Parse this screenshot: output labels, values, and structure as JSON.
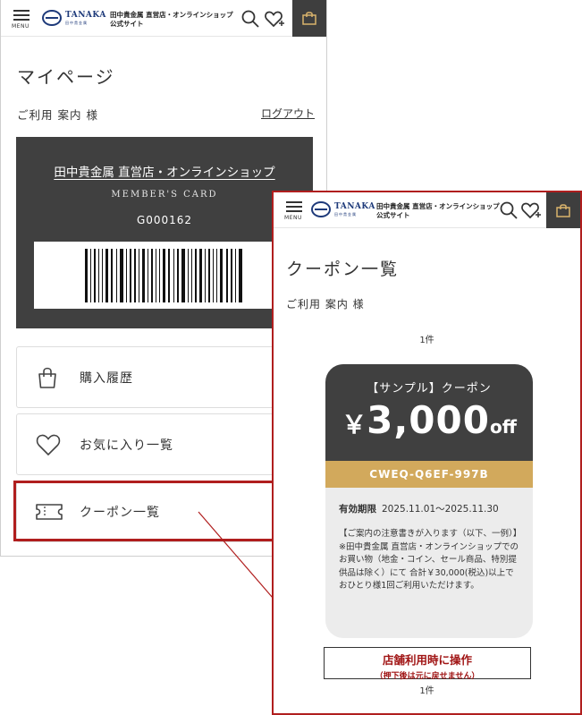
{
  "header": {
    "menu_label": "MENU",
    "logo_en": "TANAKA",
    "logo_jp": "田中貴金属",
    "store_line1": "田中貴金属 直営店・オンラインショップ",
    "store_line2": "公式サイト"
  },
  "mypage": {
    "title": "マイページ",
    "user_line": "ご利用 案内 様",
    "logout_label": "ログアウト",
    "card": {
      "title": "田中貴金属 直営店・オンラインショップ",
      "subtitle": "MEMBER'S CARD",
      "number": "G000162"
    },
    "menu": [
      {
        "label": "購入履歴",
        "icon": "shopping-bag-icon"
      },
      {
        "label": "お気に入り一覧",
        "icon": "heart-icon"
      },
      {
        "label": "クーポン一覧",
        "icon": "ticket-icon"
      }
    ]
  },
  "coupon_page": {
    "title": "クーポン一覧",
    "user_line": "ご利用 案内 様",
    "count_top": "1件",
    "count_bottom": "1件",
    "coupon": {
      "name": "【サンプル】クーポン",
      "yen": "￥",
      "amount": "3,000",
      "off": "off",
      "code": "CWEQ-Q6EF-997B",
      "valid_label": "有効期限",
      "valid_range": "2025.11.01～2025.11.30",
      "note": "【ご案内の注意書きが入ります（以下、一例）】※田中貴金属 直営店・オンラインショップでのお買い物（地金・コイン、セール商品、特別提供品は除く）にて 合計￥30,000(税込)以上でおひとり様1回ご利用いただけます。"
    },
    "store_button": {
      "line1": "店舗利用時に操作",
      "line2": "（押下後は元に戻せません）"
    }
  },
  "colors": {
    "accent_red": "#b01e1e",
    "card_dark": "#404040",
    "coupon_gold": "#d2a95c",
    "brand_blue": "#1e3a7a"
  }
}
